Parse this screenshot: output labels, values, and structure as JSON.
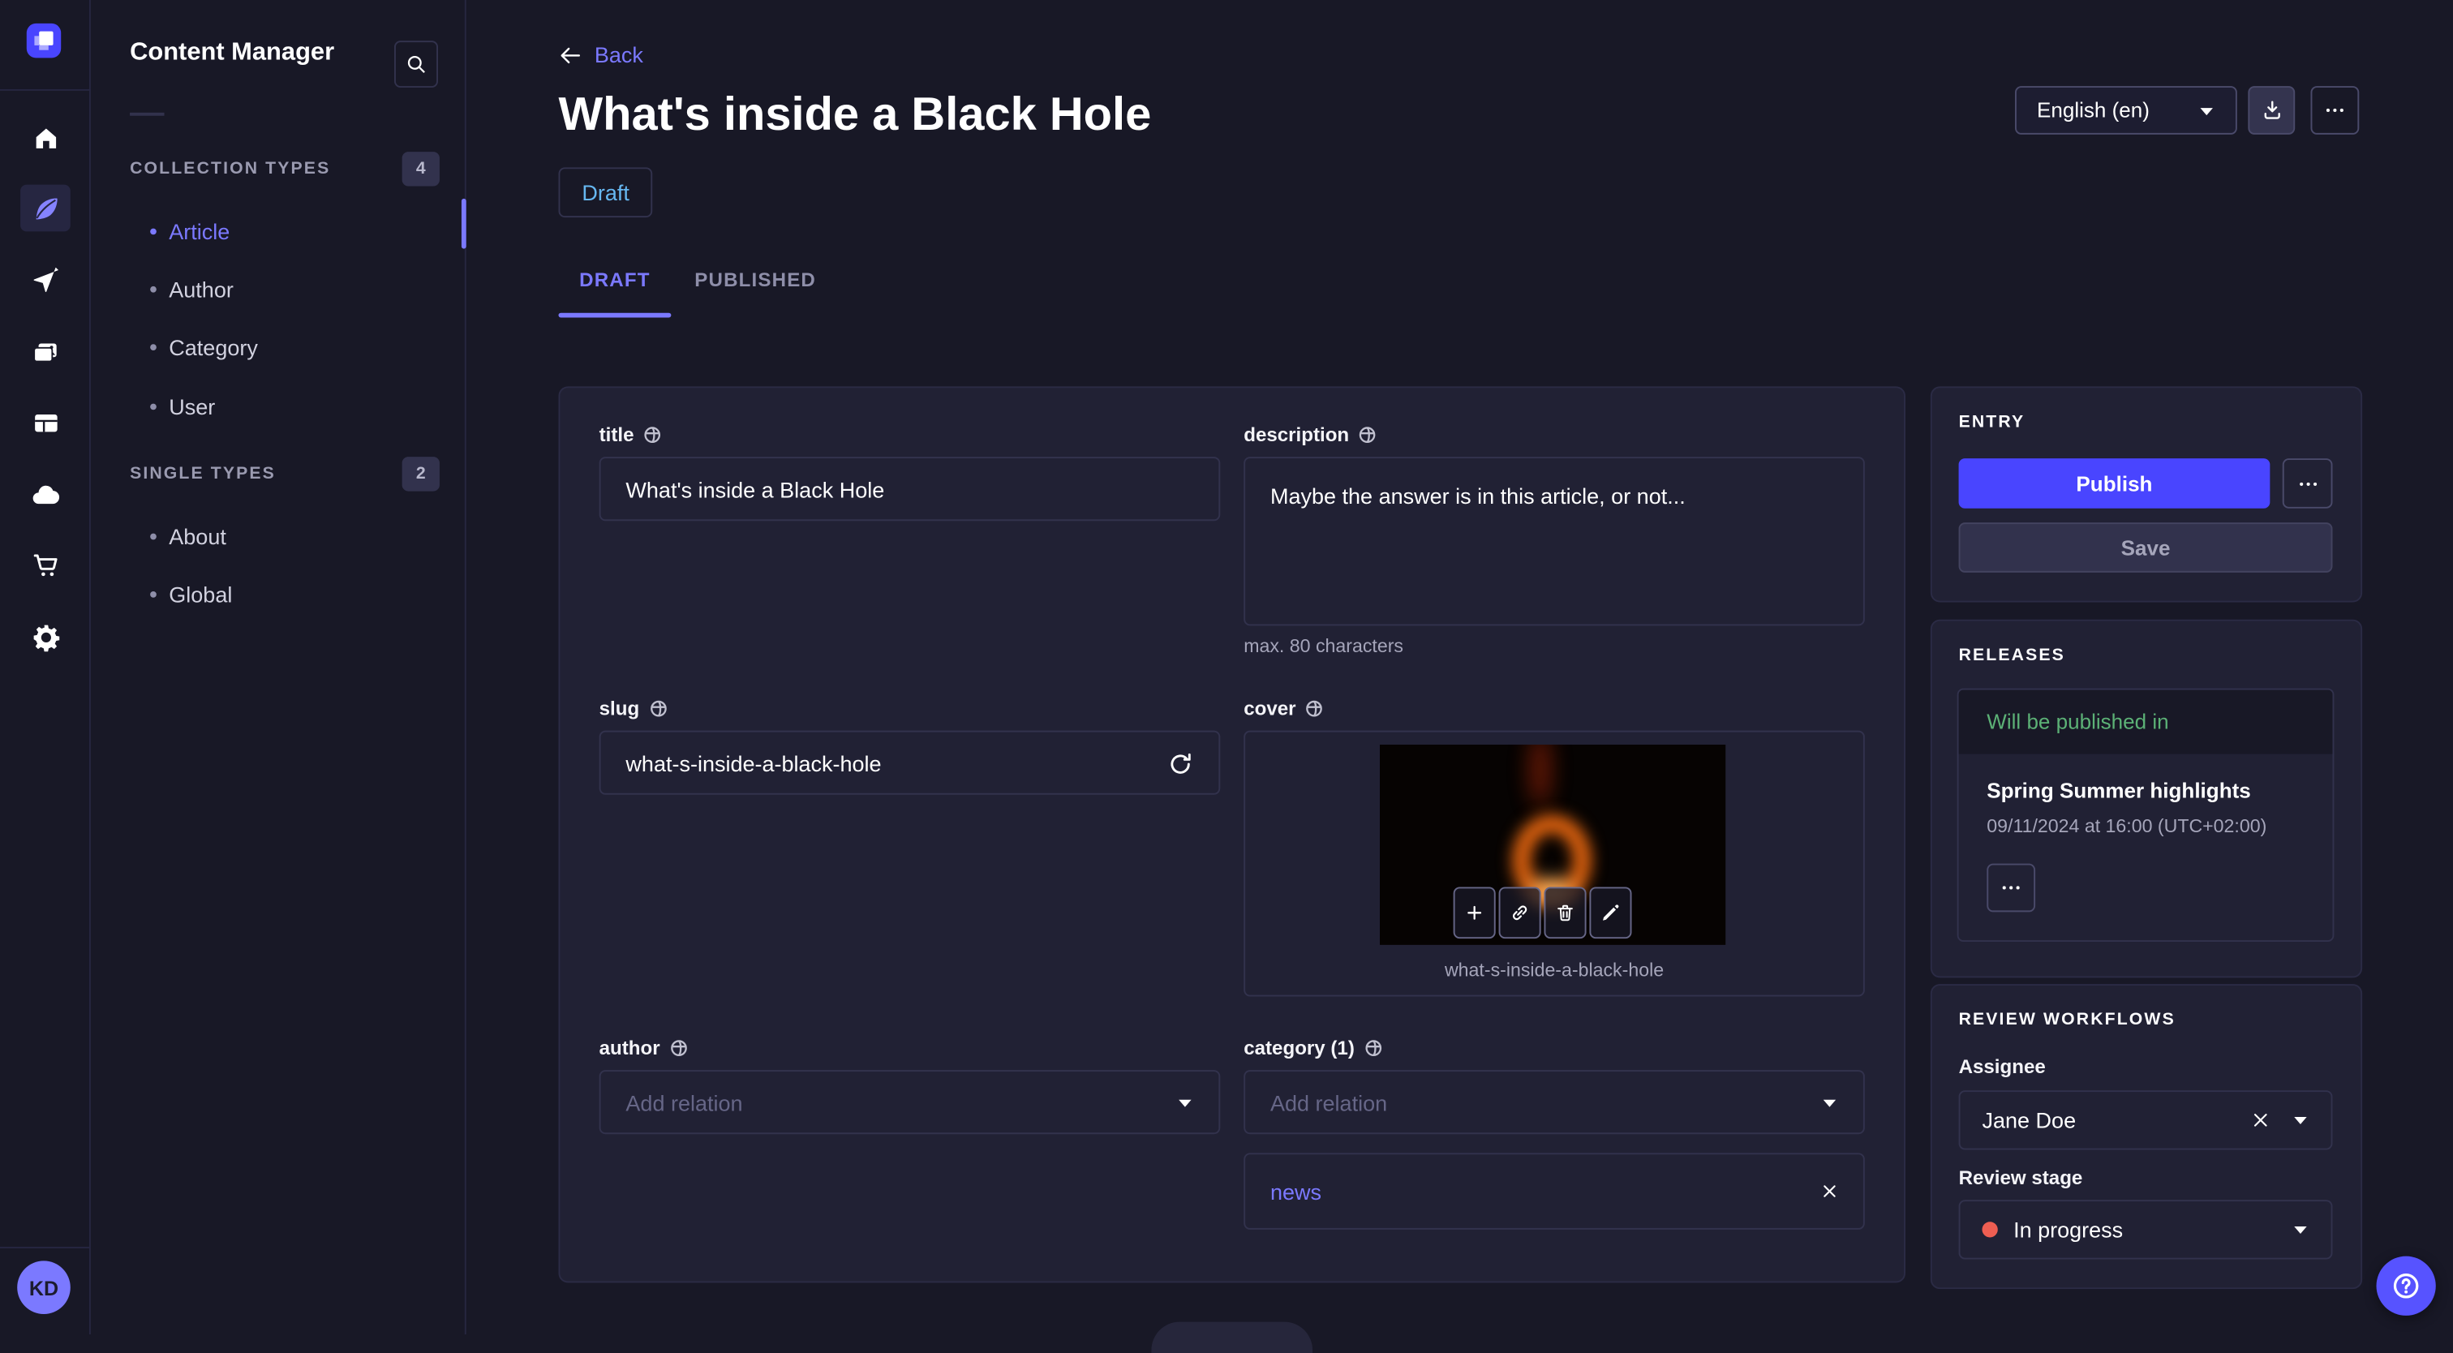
{
  "colors": {
    "page_bg": "#181826",
    "card_bg": "#212134",
    "primary": "#4945ff",
    "primary_light": "#7b79ff",
    "draft_blue": "#66b7f1",
    "success_green": "#5cb176",
    "danger_red": "#ee5e52"
  },
  "icon_rail": {
    "logo_icon": "strapi-logo",
    "items": [
      "home",
      "content-manager",
      "releases",
      "media-library",
      "content-type-builder",
      "deploy",
      "marketplace",
      "settings"
    ],
    "active_item": "content-manager",
    "user_initials": "KD"
  },
  "content_sidebar": {
    "title": "Content Manager",
    "search_icon": "search-icon",
    "collection_types": {
      "label": "COLLECTION TYPES",
      "count": "4",
      "items": [
        {
          "label": "Article",
          "active": true
        },
        {
          "label": "Author",
          "active": false
        },
        {
          "label": "Category",
          "active": false
        },
        {
          "label": "User",
          "active": false
        }
      ]
    },
    "single_types": {
      "label": "SINGLE TYPES",
      "count": "2",
      "items": [
        {
          "label": "About",
          "active": false
        },
        {
          "label": "Global",
          "active": false
        }
      ]
    }
  },
  "header": {
    "back_label": "Back",
    "title": "What's inside a Black Hole",
    "status_badge": "Draft",
    "locale_select_value": "English (en)",
    "tabs": [
      {
        "label": "DRAFT",
        "active": true
      },
      {
        "label": "PUBLISHED",
        "active": false
      }
    ]
  },
  "form": {
    "title_field": {
      "label": "title",
      "value": "What's inside a Black Hole"
    },
    "description_field": {
      "label": "description",
      "value": "Maybe the answer is in this article, or not...",
      "helper": "max. 80 characters"
    },
    "slug_field": {
      "label": "slug",
      "value": "what-s-inside-a-black-hole"
    },
    "cover_field": {
      "label": "cover",
      "caption": "what-s-inside-a-black-hole"
    },
    "author_field": {
      "label": "author",
      "placeholder": "Add relation"
    },
    "category_field": {
      "label": "category (1)",
      "placeholder": "Add relation",
      "relations": [
        {
          "label": "news"
        }
      ]
    }
  },
  "entry_panel": {
    "title": "ENTRY",
    "publish_label": "Publish",
    "save_label": "Save"
  },
  "releases_panel": {
    "title": "RELEASES",
    "card": {
      "header": "Will be published in",
      "release_title": "Spring Summer highlights",
      "date": "09/11/2024 at 16:00 (UTC+02:00)"
    }
  },
  "review_panel": {
    "title": "REVIEW WORKFLOWS",
    "assignee_label": "Assignee",
    "assignee_value": "Jane Doe",
    "stage_label": "Review stage",
    "stage_value": "In progress"
  }
}
